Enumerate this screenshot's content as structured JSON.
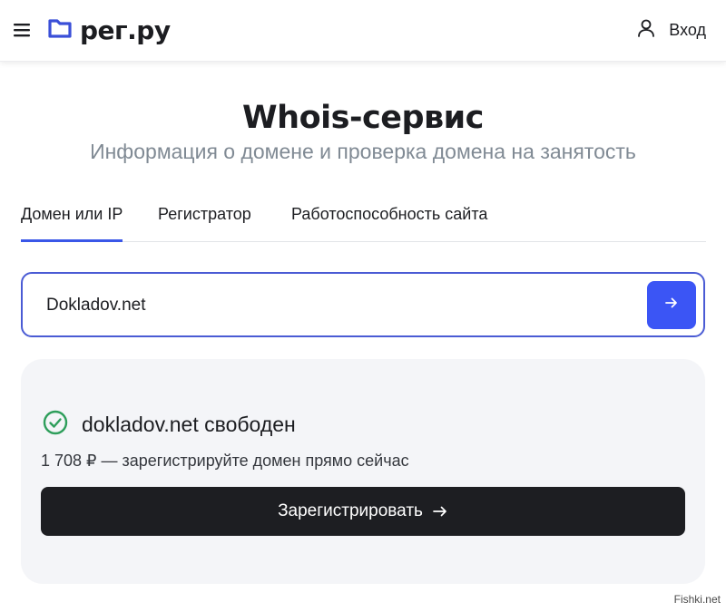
{
  "header": {
    "logo_text": "рег.ру",
    "login_label": "Вход",
    "menu_icon": "hamburger-icon",
    "logo_icon": "folder-icon",
    "login_icon": "user-icon"
  },
  "main": {
    "title": "Whois-сервис",
    "subtitle": "Информация о домене и проверка домена на занятость",
    "tabs": [
      {
        "label": "Домен или IP",
        "active": true
      },
      {
        "label": "Регистратор",
        "active": false
      },
      {
        "label": "Работоспособность сайта",
        "active": false
      }
    ],
    "search": {
      "value": "Dokladov.net",
      "button_icon": "arrow-right-icon"
    },
    "result": {
      "status_icon": "check-circle-icon",
      "status_text": "dokladov.net свободен",
      "price_text": "1 708 ₽ — зарегистрируйте домен прямо сейчас",
      "register_label": "Зарегистрировать",
      "register_icon": "arrow-right-icon"
    }
  },
  "watermark": "Fishki.net",
  "colors": {
    "accent": "#3b55f5",
    "tab_underline": "#3a57e8",
    "success": "#2e9e5b",
    "dark_button": "#1d1e22",
    "card_bg": "#f4f5f8",
    "logo_blue": "#3a4fd8"
  }
}
